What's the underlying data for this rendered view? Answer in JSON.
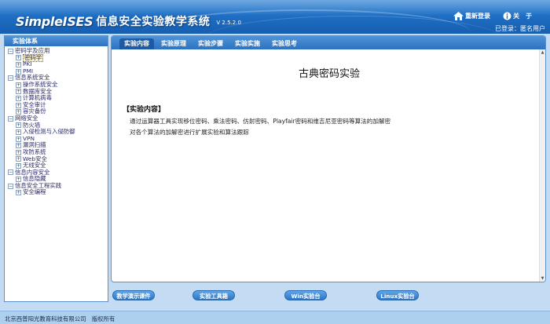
{
  "header": {
    "logo_en": "SimpleISES",
    "logo_cn": "信息安全实验教学系统",
    "version": "V 2.5.2.0",
    "relogin_label": "重新登录",
    "about_label": "关　于",
    "status": "已登录：匿名用户"
  },
  "sidebar": {
    "title": "实验体系",
    "items": [
      {
        "label": "密码学及应用",
        "level": 0,
        "toggle": "⊟"
      },
      {
        "label": "密码学",
        "level": 1,
        "toggle": "⊞"
      },
      {
        "label": "PKI",
        "level": 1,
        "toggle": "⊞"
      },
      {
        "label": "PMI",
        "level": 1,
        "toggle": "⊞"
      },
      {
        "label": "信息系统安全",
        "level": 0,
        "toggle": "⊟"
      },
      {
        "label": "操作系统安全",
        "level": 1,
        "toggle": "⊞"
      },
      {
        "label": "数据库安全",
        "level": 1,
        "toggle": "⊞"
      },
      {
        "label": "计算机病毒",
        "level": 1,
        "toggle": "⊞"
      },
      {
        "label": "安全审计",
        "level": 1,
        "toggle": "⊞"
      },
      {
        "label": "容灾备份",
        "level": 1,
        "toggle": "⊞"
      },
      {
        "label": "网络安全",
        "level": 0,
        "toggle": "⊟"
      },
      {
        "label": "防火墙",
        "level": 1,
        "toggle": "⊞"
      },
      {
        "label": "入侵检测与入侵防御",
        "level": 1,
        "toggle": "⊞"
      },
      {
        "label": "VPN",
        "level": 1,
        "toggle": "⊞"
      },
      {
        "label": "漏洞扫描",
        "level": 1,
        "toggle": "⊞"
      },
      {
        "label": "攻防系统",
        "level": 1,
        "toggle": "⊞"
      },
      {
        "label": "Web安全",
        "level": 1,
        "toggle": "⊞"
      },
      {
        "label": "无线安全",
        "level": 1,
        "toggle": "⊞"
      },
      {
        "label": "信息内容安全",
        "level": 0,
        "toggle": "⊟"
      },
      {
        "label": "信息隐藏",
        "level": 1,
        "toggle": "⊞"
      },
      {
        "label": "信息安全工程实践",
        "level": 0,
        "toggle": "⊟"
      },
      {
        "label": "安全编程",
        "level": 1,
        "toggle": "⊞"
      }
    ]
  },
  "tabs": [
    "实验内容",
    "实验原理",
    "实验步骤",
    "实验实施",
    "实验思考"
  ],
  "content": {
    "title": "古典密码实验",
    "section_title": "【实验内容】",
    "lines": [
      "通过运算器工具实现移位密码、乘法密码、仿射密码、Playfair密码和维吉尼亚密码等算法的加解密",
      "对各个算法的加解密进行扩展实验和算法跟踪"
    ]
  },
  "buttons": {
    "demo": "教学演示课件",
    "tools": "实验工具箱",
    "win": "Win实验台",
    "linux": "Linux实验台"
  },
  "footer": {
    "copyright": "北京西普阳光教育科技有限公司　版权所有"
  },
  "colors": {
    "header_blue": "#1f6fc4",
    "panel_border": "#5b91cc",
    "page_bg": "#c4dcf3"
  }
}
